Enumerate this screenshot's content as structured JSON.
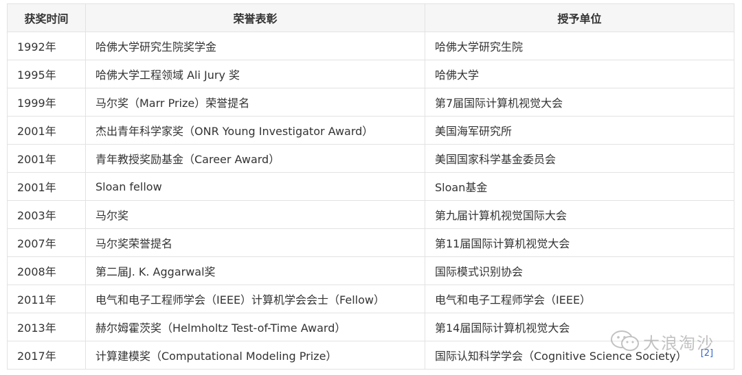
{
  "table": {
    "headers": [
      "获奖时间",
      "荣誉表彰",
      "授予单位"
    ],
    "rows": [
      {
        "year": "1992年",
        "honor": "哈佛大学研究生院奖学金",
        "org": "哈佛大学研究生院"
      },
      {
        "year": "1995年",
        "honor": "哈佛大学工程领域 Ali Jury 奖",
        "org": "哈佛大学"
      },
      {
        "year": "1999年",
        "honor": "马尔奖（Marr Prize）荣誉提名",
        "org": "第7届国际计算机视觉大会"
      },
      {
        "year": "2001年",
        "honor": "杰出青年科学家奖（ONR Young Investigator Award）",
        "org": "美国海军研究所"
      },
      {
        "year": "2001年",
        "honor": "青年教授奖励基金（Career Award）",
        "org": "美国国家科学基金委员会"
      },
      {
        "year": "2001年",
        "honor": "Sloan fellow",
        "org": "Sloan基金"
      },
      {
        "year": "2003年",
        "honor": "马尔奖",
        "org": "第九届计算机视觉国际大会"
      },
      {
        "year": "2007年",
        "honor": "马尔奖荣誉提名",
        "org": "第11届国际计算机视觉大会"
      },
      {
        "year": "2008年",
        "honor": "第二届J. K. Aggarwal奖",
        "org": "国际模式识别协会"
      },
      {
        "year": "2011年",
        "honor": "电气和电子工程师学会（IEEE）计算机学会会士（Fellow）",
        "org": "电气和电子工程师学会（IEEE）"
      },
      {
        "year": "2013年",
        "honor": "赫尔姆霍茨奖（Helmholtz Test-of-Time Award）",
        "org": "第14届国际计算机视觉大会"
      },
      {
        "year": "2017年",
        "honor": "计算建模奖（Computational Modeling Prize）",
        "org": "国际认知科学学会（Cognitive Science Society）",
        "citation": "[2]"
      }
    ]
  },
  "watermark": {
    "text": "大浪淘沙",
    "icon": "wechat-icon"
  },
  "colors": {
    "header_bg": "#f6f6f6",
    "border": "#e2e2e2",
    "link": "#3366cc"
  }
}
